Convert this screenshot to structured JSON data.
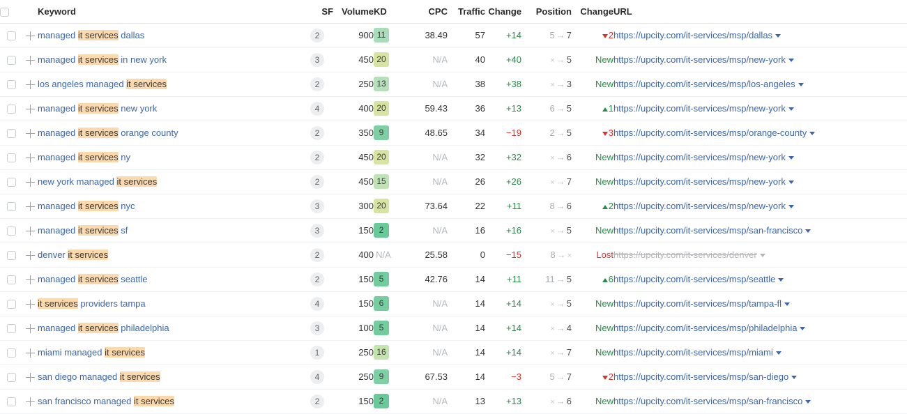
{
  "table": {
    "columns": [
      {
        "key": "keyword",
        "label": "Keyword"
      },
      {
        "key": "sf",
        "label": "SF"
      },
      {
        "key": "volume",
        "label": "Volume"
      },
      {
        "key": "kd",
        "label": "KD"
      },
      {
        "key": "cpc",
        "label": "CPC"
      },
      {
        "key": "traffic",
        "label": "Traffic"
      },
      {
        "key": "change1",
        "label": "Change"
      },
      {
        "key": "position",
        "label": "Position"
      },
      {
        "key": "change2",
        "label": "Change"
      },
      {
        "key": "url",
        "label": "URL"
      }
    ],
    "highlight_term": "it services",
    "na_text": "N/A",
    "arrow_glyph": "→",
    "x_glyph": "×",
    "icons": {
      "checkbox": "checkbox-icon",
      "plus": "plus-icon",
      "caret": "chevron-down-icon"
    },
    "colors": {
      "link": "#3a66b0",
      "highlight": "#fcd9ac",
      "positive": "#2a8a4a",
      "negative": "#d9332e",
      "muted": "#b4b9bd"
    },
    "rows": [
      {
        "keyword_parts": [
          {
            "text": "managed ",
            "hl": false
          },
          {
            "text": "it services",
            "hl": true
          },
          {
            "text": " dallas",
            "hl": false
          }
        ],
        "keyword_text": "managed it services dallas",
        "sf": "2",
        "volume": "900",
        "kd": "11",
        "kd_color": "#a9ddb9",
        "cpc": "38.49",
        "cpc_na": false,
        "traffic": "57",
        "change1": "+14",
        "change1_dir": "up",
        "pos_from": "5",
        "pos_to": "7",
        "pos_from_missing": false,
        "pos_to_missing": false,
        "status_kind": "down",
        "status_text": "2",
        "url": "https://upcity.com/it-services/msp/dallas",
        "url_lost": false
      },
      {
        "keyword_parts": [
          {
            "text": "managed ",
            "hl": false
          },
          {
            "text": "it services",
            "hl": true
          },
          {
            "text": " in new york",
            "hl": false
          }
        ],
        "keyword_text": "managed it services in new york",
        "sf": "3",
        "volume": "450",
        "kd": "20",
        "kd_color": "#d7e4a0",
        "cpc": "N/A",
        "cpc_na": true,
        "traffic": "40",
        "change1": "+40",
        "change1_dir": "up",
        "pos_from": "",
        "pos_to": "5",
        "pos_from_missing": true,
        "pos_to_missing": false,
        "status_kind": "new",
        "status_text": "New",
        "url": "https://upcity.com/it-services/msp/new-york",
        "url_lost": false
      },
      {
        "keyword_parts": [
          {
            "text": "los angeles managed ",
            "hl": false
          },
          {
            "text": "it services",
            "hl": true
          }
        ],
        "keyword_text": "los angeles managed it services",
        "sf": "2",
        "volume": "250",
        "kd": "13",
        "kd_color": "#b5e0bb",
        "cpc": "N/A",
        "cpc_na": true,
        "traffic": "38",
        "change1": "+38",
        "change1_dir": "up",
        "pos_from": "",
        "pos_to": "3",
        "pos_from_missing": true,
        "pos_to_missing": false,
        "status_kind": "new",
        "status_text": "New",
        "url": "https://upcity.com/it-services/msp/los-angeles",
        "url_lost": false
      },
      {
        "keyword_parts": [
          {
            "text": "managed ",
            "hl": false
          },
          {
            "text": "it services",
            "hl": true
          },
          {
            "text": " new york",
            "hl": false
          }
        ],
        "keyword_text": "managed it services new york",
        "sf": "4",
        "volume": "400",
        "kd": "20",
        "kd_color": "#d7e4a0",
        "cpc": "59.43",
        "cpc_na": false,
        "traffic": "36",
        "change1": "+13",
        "change1_dir": "up",
        "pos_from": "6",
        "pos_to": "5",
        "pos_from_missing": false,
        "pos_to_missing": false,
        "status_kind": "up",
        "status_text": "1",
        "url": "https://upcity.com/it-services/msp/new-york",
        "url_lost": false
      },
      {
        "keyword_parts": [
          {
            "text": "managed ",
            "hl": false
          },
          {
            "text": "it services",
            "hl": true
          },
          {
            "text": " orange county",
            "hl": false
          }
        ],
        "keyword_text": "managed it services orange county",
        "sf": "2",
        "volume": "350",
        "kd": "9",
        "kd_color": "#7ed0a4",
        "cpc": "48.65",
        "cpc_na": false,
        "traffic": "34",
        "change1": "−19",
        "change1_dir": "down",
        "pos_from": "2",
        "pos_to": "5",
        "pos_from_missing": false,
        "pos_to_missing": false,
        "status_kind": "down",
        "status_text": "3",
        "url": "https://upcity.com/it-services/msp/orange-county",
        "url_lost": false
      },
      {
        "keyword_parts": [
          {
            "text": "managed ",
            "hl": false
          },
          {
            "text": "it services",
            "hl": true
          },
          {
            "text": " ny",
            "hl": false
          }
        ],
        "keyword_text": "managed it services ny",
        "sf": "2",
        "volume": "450",
        "kd": "20",
        "kd_color": "#d7e4a0",
        "cpc": "N/A",
        "cpc_na": true,
        "traffic": "32",
        "change1": "+32",
        "change1_dir": "up",
        "pos_from": "",
        "pos_to": "6",
        "pos_from_missing": true,
        "pos_to_missing": false,
        "status_kind": "new",
        "status_text": "New",
        "url": "https://upcity.com/it-services/msp/new-york",
        "url_lost": false
      },
      {
        "keyword_parts": [
          {
            "text": "new york managed ",
            "hl": false
          },
          {
            "text": "it services",
            "hl": true
          }
        ],
        "keyword_text": "new york managed it services",
        "sf": "2",
        "volume": "450",
        "kd": "15",
        "kd_color": "#bfe3b4",
        "cpc": "N/A",
        "cpc_na": true,
        "traffic": "26",
        "change1": "+26",
        "change1_dir": "up",
        "pos_from": "",
        "pos_to": "7",
        "pos_from_missing": true,
        "pos_to_missing": false,
        "status_kind": "new",
        "status_text": "New",
        "url": "https://upcity.com/it-services/msp/new-york",
        "url_lost": false
      },
      {
        "keyword_parts": [
          {
            "text": "managed ",
            "hl": false
          },
          {
            "text": "it services",
            "hl": true
          },
          {
            "text": " nyc",
            "hl": false
          }
        ],
        "keyword_text": "managed it services nyc",
        "sf": "3",
        "volume": "300",
        "kd": "20",
        "kd_color": "#d7e4a0",
        "cpc": "73.64",
        "cpc_na": false,
        "traffic": "22",
        "change1": "+11",
        "change1_dir": "up",
        "pos_from": "8",
        "pos_to": "6",
        "pos_from_missing": false,
        "pos_to_missing": false,
        "status_kind": "up",
        "status_text": "2",
        "url": "https://upcity.com/it-services/msp/new-york",
        "url_lost": false
      },
      {
        "keyword_parts": [
          {
            "text": "managed ",
            "hl": false
          },
          {
            "text": "it services",
            "hl": true
          },
          {
            "text": " sf",
            "hl": false
          }
        ],
        "keyword_text": "managed it services sf",
        "sf": "3",
        "volume": "150",
        "kd": "2",
        "kd_color": "#68c999",
        "cpc": "N/A",
        "cpc_na": true,
        "traffic": "16",
        "change1": "+16",
        "change1_dir": "up",
        "pos_from": "",
        "pos_to": "5",
        "pos_from_missing": true,
        "pos_to_missing": false,
        "status_kind": "new",
        "status_text": "New",
        "url": "https://upcity.com/it-services/msp/san-francisco",
        "url_lost": false
      },
      {
        "keyword_parts": [
          {
            "text": "denver ",
            "hl": false
          },
          {
            "text": "it services",
            "hl": true
          }
        ],
        "keyword_text": "denver it services",
        "sf": "2",
        "volume": "400",
        "kd": "N/A",
        "kd_color": "",
        "cpc": "25.58",
        "cpc_na": false,
        "traffic": "0",
        "change1": "−15",
        "change1_dir": "down",
        "pos_from": "8",
        "pos_to": "",
        "pos_from_missing": false,
        "pos_to_missing": true,
        "status_kind": "lost",
        "status_text": "Lost",
        "url": "https://upcity.com/it-services/denver",
        "url_lost": true
      },
      {
        "keyword_parts": [
          {
            "text": "managed ",
            "hl": false
          },
          {
            "text": "it services",
            "hl": true
          },
          {
            "text": " seattle",
            "hl": false
          }
        ],
        "keyword_text": "managed it services seattle",
        "sf": "2",
        "volume": "150",
        "kd": "5",
        "kd_color": "#72cc9d",
        "cpc": "42.76",
        "cpc_na": false,
        "traffic": "14",
        "change1": "+11",
        "change1_dir": "up",
        "pos_from": "11",
        "pos_to": "5",
        "pos_from_missing": false,
        "pos_to_missing": false,
        "status_kind": "up",
        "status_text": "6",
        "url": "https://upcity.com/it-services/msp/seattle",
        "url_lost": false
      },
      {
        "keyword_parts": [
          {
            "text": "it services",
            "hl": true
          },
          {
            "text": " providers tampa",
            "hl": false
          }
        ],
        "keyword_text": "it services providers tampa",
        "sf": "4",
        "volume": "150",
        "kd": "6",
        "kd_color": "#76cd9f",
        "cpc": "N/A",
        "cpc_na": true,
        "traffic": "14",
        "change1": "+14",
        "change1_dir": "up",
        "pos_from": "",
        "pos_to": "5",
        "pos_from_missing": true,
        "pos_to_missing": false,
        "status_kind": "new",
        "status_text": "New",
        "url": "https://upcity.com/it-services/msp/tampa-fl",
        "url_lost": false
      },
      {
        "keyword_parts": [
          {
            "text": "managed ",
            "hl": false
          },
          {
            "text": "it services",
            "hl": true
          },
          {
            "text": " philadelphia",
            "hl": false
          }
        ],
        "keyword_text": "managed it services philadelphia",
        "sf": "3",
        "volume": "100",
        "kd": "5",
        "kd_color": "#72cc9d",
        "cpc": "N/A",
        "cpc_na": true,
        "traffic": "14",
        "change1": "+14",
        "change1_dir": "up",
        "pos_from": "",
        "pos_to": "4",
        "pos_from_missing": true,
        "pos_to_missing": false,
        "status_kind": "new",
        "status_text": "New",
        "url": "https://upcity.com/it-services/msp/philadelphia",
        "url_lost": false
      },
      {
        "keyword_parts": [
          {
            "text": "miami managed ",
            "hl": false
          },
          {
            "text": "it services",
            "hl": true
          }
        ],
        "keyword_text": "miami managed it services",
        "sf": "1",
        "volume": "250",
        "kd": "16",
        "kd_color": "#c4e4ae",
        "cpc": "N/A",
        "cpc_na": true,
        "traffic": "14",
        "change1": "+14",
        "change1_dir": "up",
        "pos_from": "",
        "pos_to": "7",
        "pos_from_missing": true,
        "pos_to_missing": false,
        "status_kind": "new",
        "status_text": "New",
        "url": "https://upcity.com/it-services/msp/miami",
        "url_lost": false
      },
      {
        "keyword_parts": [
          {
            "text": "san diego managed ",
            "hl": false
          },
          {
            "text": "it services",
            "hl": true
          }
        ],
        "keyword_text": "san diego managed it services",
        "sf": "4",
        "volume": "250",
        "kd": "9",
        "kd_color": "#7ed0a4",
        "cpc": "67.53",
        "cpc_na": false,
        "traffic": "14",
        "change1": "−3",
        "change1_dir": "down",
        "pos_from": "5",
        "pos_to": "7",
        "pos_from_missing": false,
        "pos_to_missing": false,
        "status_kind": "down",
        "status_text": "2",
        "url": "https://upcity.com/it-services/msp/san-diego",
        "url_lost": false
      },
      {
        "keyword_parts": [
          {
            "text": "san francisco managed ",
            "hl": false
          },
          {
            "text": "it services",
            "hl": true
          }
        ],
        "keyword_text": "san francisco managed it services",
        "sf": "2",
        "volume": "150",
        "kd": "2",
        "kd_color": "#68c999",
        "cpc": "N/A",
        "cpc_na": true,
        "traffic": "13",
        "change1": "+13",
        "change1_dir": "up",
        "pos_from": "",
        "pos_to": "6",
        "pos_from_missing": true,
        "pos_to_missing": false,
        "status_kind": "new",
        "status_text": "New",
        "url": "https://upcity.com/it-services/msp/san-francisco",
        "url_lost": false
      }
    ]
  }
}
